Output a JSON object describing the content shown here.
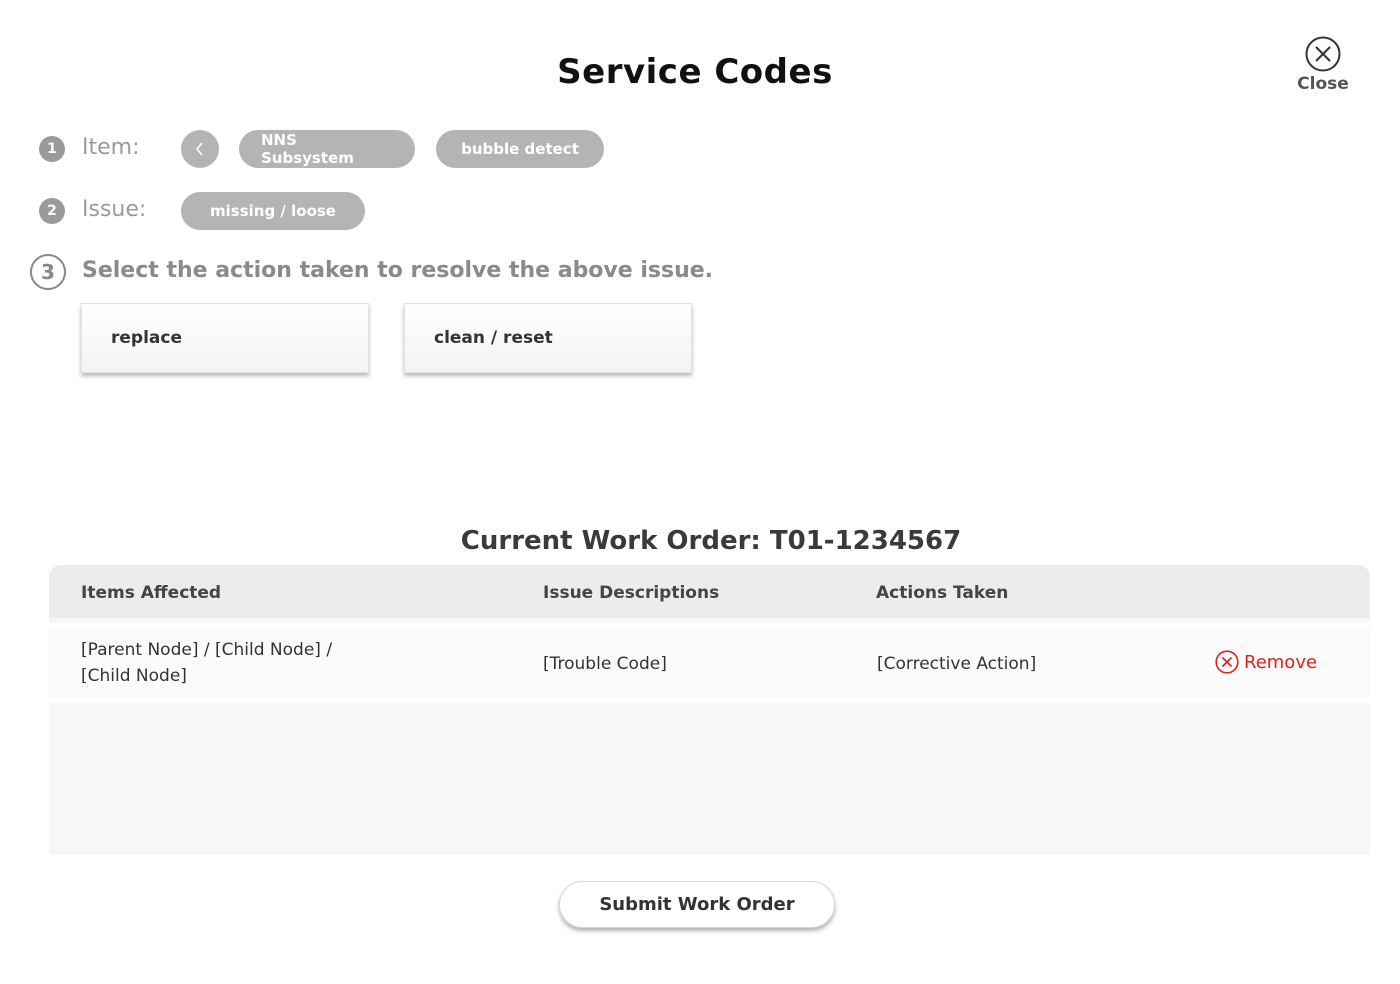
{
  "header": {
    "title": "Service Codes",
    "close_label": "Close"
  },
  "steps": {
    "item": {
      "number": "1",
      "label": "Item:",
      "breadcrumbs": [
        "NNS Subsystem",
        "bubble detect"
      ]
    },
    "issue": {
      "number": "2",
      "label": "Issue:",
      "selected": "missing / loose"
    },
    "action": {
      "number": "3",
      "prompt": "Select the action taken to resolve the above issue.",
      "options": [
        "replace",
        "clean / reset"
      ]
    }
  },
  "work_order": {
    "title": "Current Work Order: T01-1234567",
    "columns": [
      "Items Affected",
      "Issue Descriptions",
      "Actions Taken"
    ],
    "rows": [
      {
        "item": "[Parent Node] / [Child Node] / [Child Node]",
        "issue": "[Trouble Code]",
        "action": "[Corrective Action]",
        "remove_label": "Remove"
      }
    ]
  },
  "submit_label": "Submit Work Order",
  "colors": {
    "accent_red": "#e0211b",
    "pill_gray": "#b4b4b4",
    "step_gray": "#9a9a9a"
  }
}
